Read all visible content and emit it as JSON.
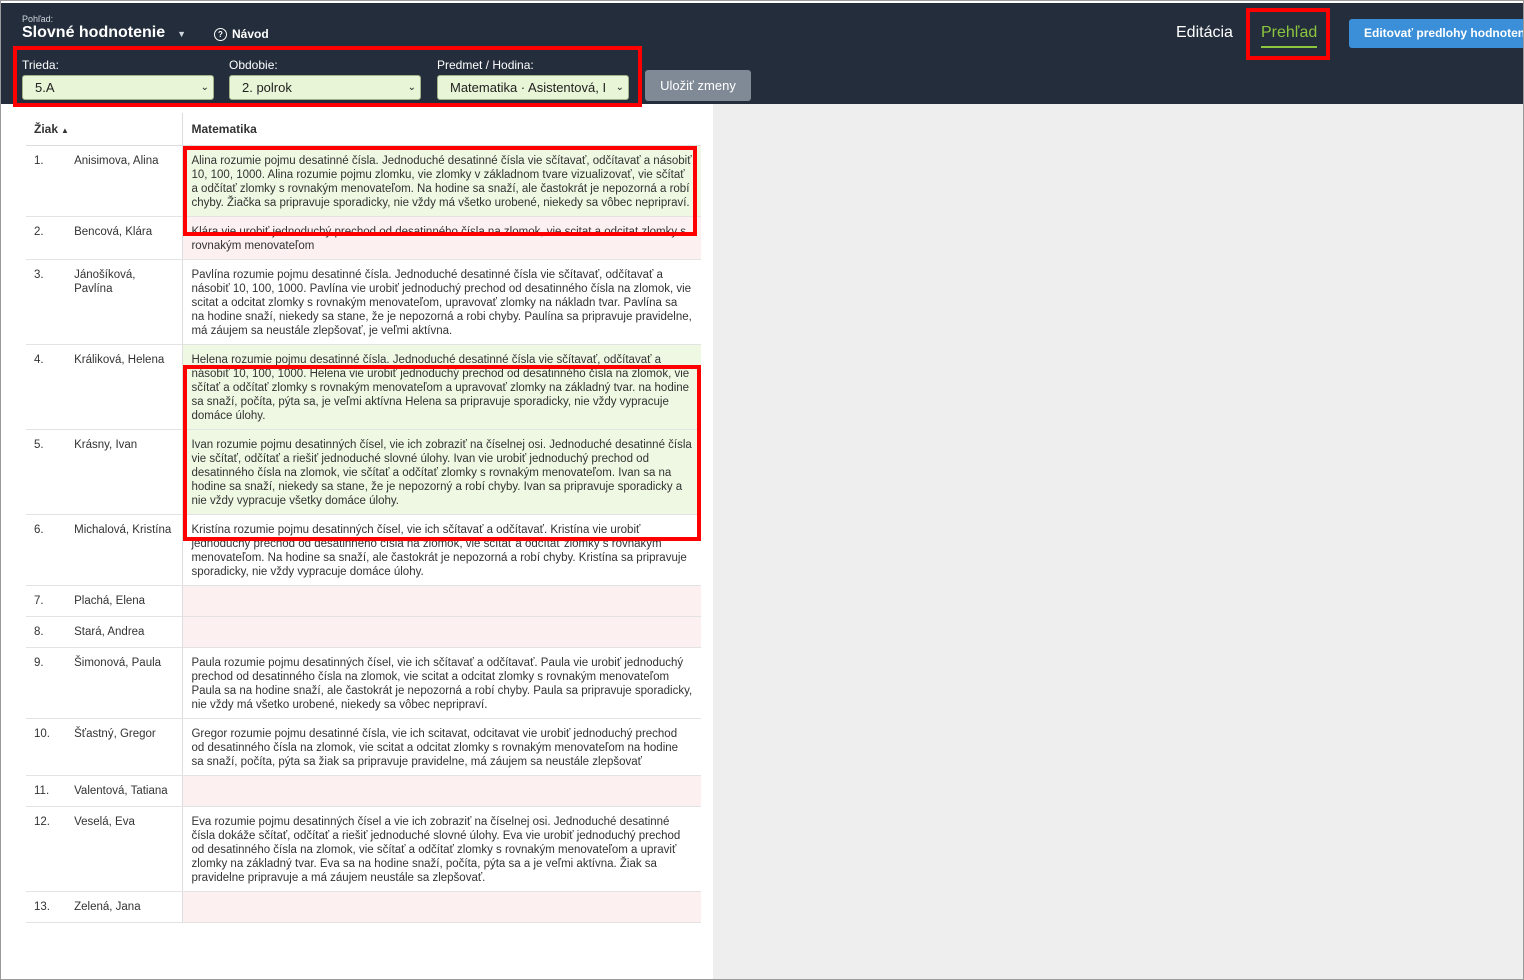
{
  "header": {
    "view_label": "Pohľad:",
    "view_title": "Slovné hodnotenie",
    "help_label": "Návod",
    "nav_edit": "Editácia",
    "nav_overview": "Prehľad",
    "templates_button": "Editovať predlohy hodnotení"
  },
  "filters": {
    "class_label": "Trieda:",
    "class_value": "5.A",
    "period_label": "Obdobie:",
    "period_value": "2. polrok",
    "subject_label": "Predmet / Hodina:",
    "subject_value": "Matematika · Asistentová, I",
    "save_button": "Uložiť zmeny"
  },
  "table": {
    "col_student": "Žiak",
    "col_subject": "Matematika",
    "rows": [
      {
        "num": "1.",
        "name": "Anisimova, Alina",
        "text": "Alina rozumie pojmu desatinné čísla. Jednoduché desatinné čísla vie sčítavať, odčítavať a násobiť 10, 100, 1000. Alina rozumie pojmu zlomku, vie zlomky v základnom tvare vizualizovať, vie sčítať a odčítať zlomky s rovnakým menovateľom. Na hodine sa snaží, ale častokrát je nepozorná a robí chyby. Žiačka sa pripravuje sporadicky, nie vždy má všetko urobené, niekedy sa vôbec nepripraví."
      },
      {
        "num": "2.",
        "name": "Bencová, Klára",
        "text": "Klára vie urobiť jednoduchý prechod od desatinného čísla na zlomok, vie scitat a odcitat zlomky s rovnakým menovateľom"
      },
      {
        "num": "3.",
        "name": "Jánošíková, Pavlína",
        "text": "Pavlína rozumie pojmu desatinné čísla. Jednoduché desatinné čísla vie sčítavať, odčítavať a násobiť 10, 100, 1000. Pavlína vie urobiť jednoduchý prechod od desatinného čísla na zlomok, vie scitat a odcitat zlomky s rovnakým menovateľom, upravovať zlomky na nákladn tvar. Pavlína sa na hodine snaží, niekedy sa stane, že je nepozorná a robi chyby. Paulína sa pripravuje pravidelne, má záujem sa neustále zlepšovať, je veľmi aktívna."
      },
      {
        "num": "4.",
        "name": "Králiková, Helena",
        "text": "Helena rozumie pojmu desatinné čísla. Jednoduché desatinné čísla vie sčítavať, odčítavať a násobiť 10, 100, 1000. Helena vie urobiť jednoduchý prechod od desatinného čísla na zlomok, vie sčítať a odčítať zlomky s rovnakým menovateľom a upravovať zlomky na základný tvar. na hodine sa snaží, počíta, pýta sa, je veľmi aktívna Helena sa pripravuje sporadicky, nie vždy vypracuje domáce úlohy."
      },
      {
        "num": "5.",
        "name": "Krásny, Ivan",
        "text": "Ivan rozumie pojmu desatinných čísel, vie ich zobraziť na číselnej osi. Jednoduché desatinné čísla vie sčítať, odčítať a riešiť jednoduché slovné úlohy. Ivan vie urobiť jednoduchý prechod od desatinného čísla na zlomok, vie sčítať a odčítať zlomky s rovnakým menovateľom. Ivan sa na hodine sa snaží, niekedy sa stane, že je nepozorný a robí chyby. Ivan sa pripravuje sporadicky a nie vždy vypracuje všetky domáce úlohy."
      },
      {
        "num": "6.",
        "name": "Michalová, Kristína",
        "text": "Kristína rozumie pojmu desatinných čísel, vie ich sčítavať a odčítavať. Kristína vie urobiť jednoduchý prechod od desatinného čísla na zlomok, vie sčítať a odčítať zlomky s rovnakým menovateľom. Na hodine sa snaží, ale častokrát je nepozorná a robí chyby. Kristína sa pripravuje sporadicky, nie vždy vypracuje domáce úlohy."
      },
      {
        "num": "7.",
        "name": "Plachá, Elena",
        "text": ""
      },
      {
        "num": "8.",
        "name": "Stará, Andrea",
        "text": ""
      },
      {
        "num": "9.",
        "name": "Šimonová, Paula",
        "text": "Paula rozumie pojmu desatinných čísel, vie ich sčítavať a odčítavať. Paula vie urobiť jednoduchý prechod od desatinného čísla na zlomok, vie scitat a odcitat zlomky s rovnakým menovateľom Paula sa na hodine snaží, ale častokrát je nepozorná a robí chyby. Paula sa pripravuje sporadicky, nie vždy má všetko urobené, niekedy sa vôbec nepripraví."
      },
      {
        "num": "10.",
        "name": "Šťastný, Gregor",
        "text": "Gregor rozumie pojmu desatinné čísla, vie ich scitavat, odcitavat vie urobiť jednoduchý prechod od desatinného čísla na zlomok, vie scitat a odcitat zlomky s rovnakým menovateľom na hodine sa snaží, počíta, pýta sa žiak sa pripravuje pravidelne, má záujem sa neustále zlepšovať"
      },
      {
        "num": "11.",
        "name": "Valentová, Tatiana",
        "text": ""
      },
      {
        "num": "12.",
        "name": "Veselá, Eva",
        "text": "Eva rozumie pojmu desatinných čísel a vie ich zobraziť na číselnej osi. Jednoduché desatinné čísla dokáže sčítať, odčítať a riešiť jednoduché slovné úlohy. Eva vie urobiť jednoduchý prechod od desatinného čísla na zlomok, vie sčítať a odčítať zlomky s rovnakým menovateľom a upraviť zlomky na základný tvar. Eva sa na hodine snaží, počíta, pýta sa a je veľmi aktívna. Žiak sa pravidelne pripravuje a má záujem neustále sa zlepšovať."
      },
      {
        "num": "13.",
        "name": "Zelená, Jana",
        "text": ""
      }
    ]
  }
}
